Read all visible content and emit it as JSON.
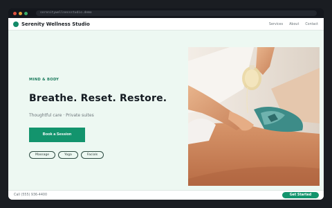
{
  "browser": {
    "url": "serenitywellnessstudio.demo"
  },
  "header": {
    "brand": "Serenity Wellness Studio",
    "nav": [
      "Services",
      "About",
      "Contact"
    ]
  },
  "hero": {
    "eyebrow": "MIND & BODY",
    "headline": "Breathe. Reset. Restore.",
    "subtitle": "Thoughtful care · Private suites",
    "cta_label": "Book a Session",
    "chips": [
      "Massage",
      "Yoga",
      "Facials"
    ]
  },
  "footer": {
    "phone": "Call (555) 936-4400",
    "cta_label": "Get Started"
  },
  "colors": {
    "accent": "#13946d",
    "background": "#edf8f2",
    "headline": "#141b22"
  }
}
